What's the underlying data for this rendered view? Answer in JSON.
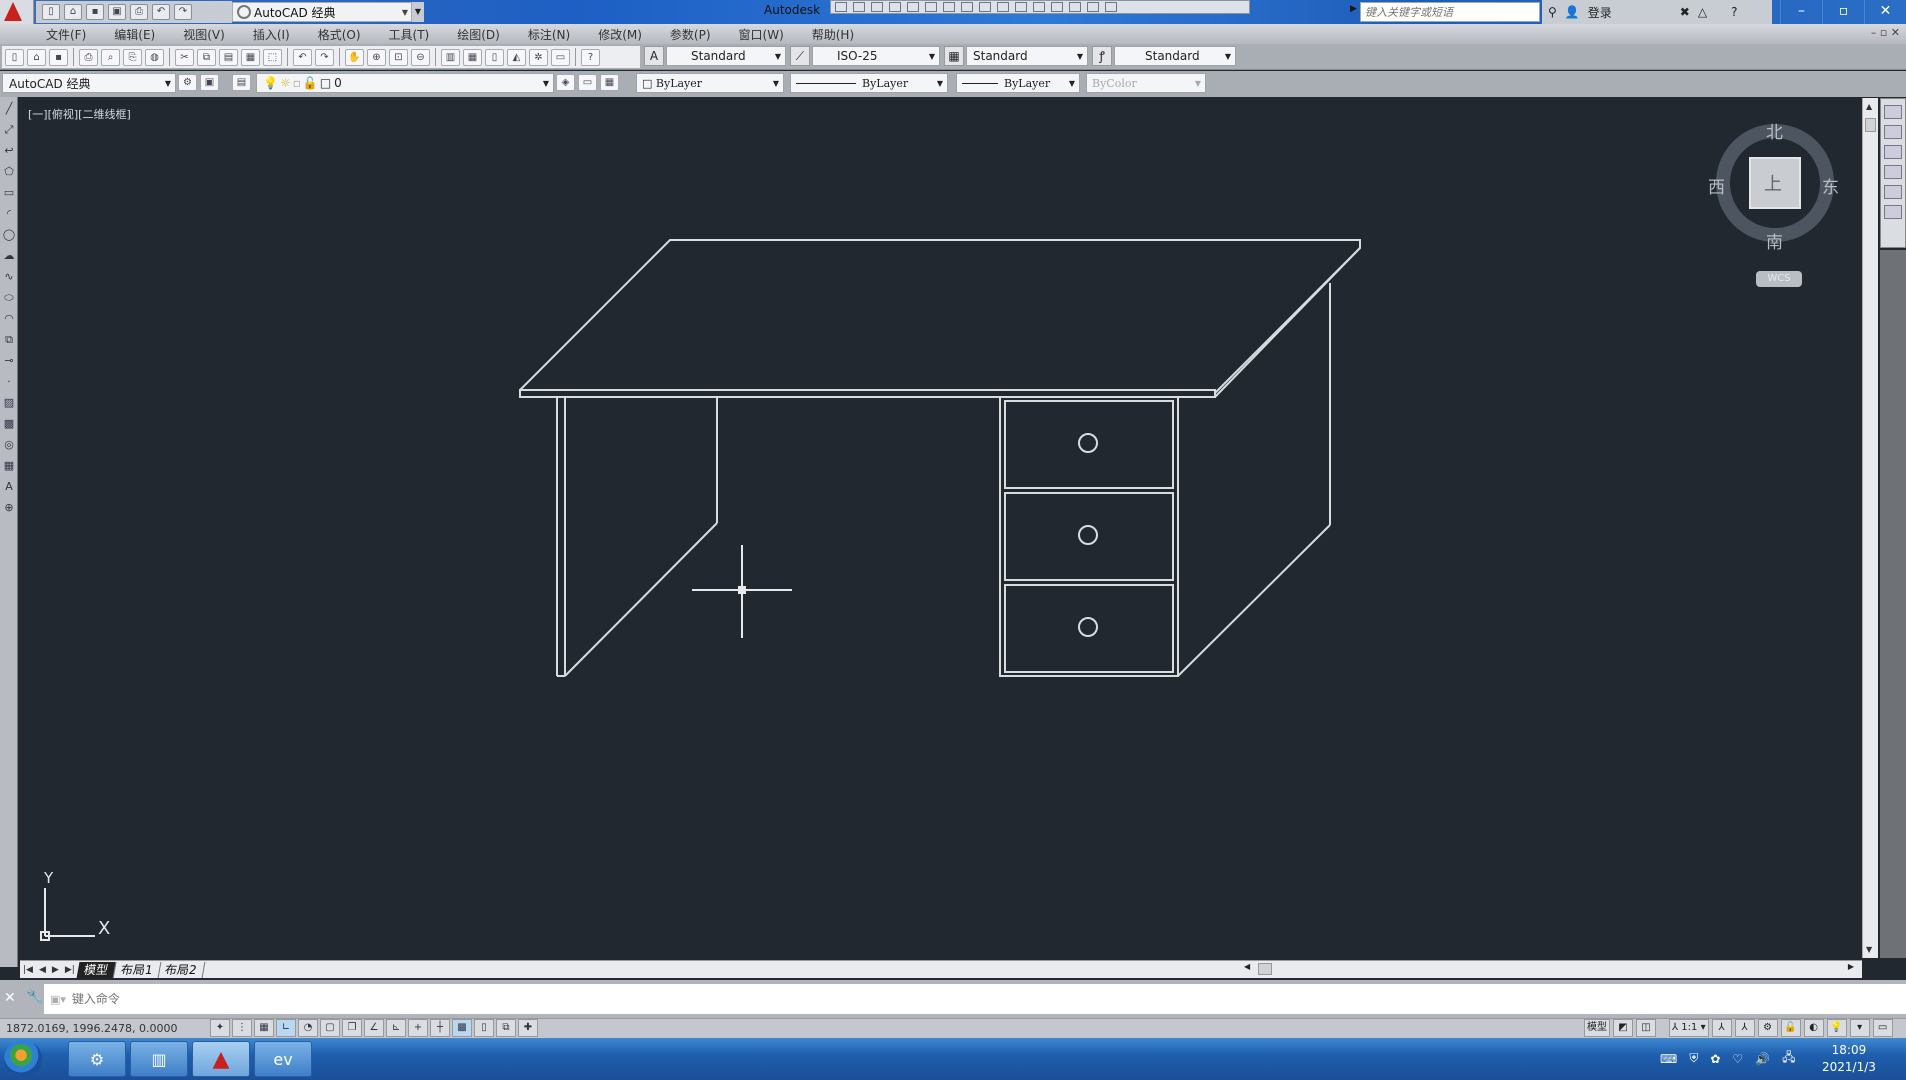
{
  "title_bar": {
    "app_name": "AutoCAD",
    "window_title": "Autodesk",
    "workspace": "AutoCAD 经典",
    "search_placeholder": "键入关键字或短语",
    "login_label": "登录",
    "quick_access": [
      "new-icon",
      "open-icon",
      "save-icon",
      "save-as-icon",
      "print-icon",
      "undo-icon",
      "redo-icon"
    ],
    "window_controls": [
      "minimize",
      "restore",
      "close"
    ]
  },
  "menubar": {
    "items": [
      "文件(F)",
      "编辑(E)",
      "视图(V)",
      "插入(I)",
      "格式(O)",
      "工具(T)",
      "绘图(D)",
      "标注(N)",
      "修改(M)",
      "参数(P)",
      "窗口(W)",
      "帮助(H)"
    ],
    "doc_controls": "– ▫ ✕"
  },
  "styles_toolbar": {
    "text_style": "Standard",
    "dim_style": "ISO-25",
    "table_style": "Standard",
    "multileader_style": "Standard"
  },
  "layers_toolbar": {
    "workspace": "AutoCAD 经典",
    "current_layer": "0",
    "color": "ByLayer",
    "linetype": "ByLayer",
    "lineweight": "ByLayer",
    "plot_style": "ByColor"
  },
  "viewport": {
    "label": "[一][俯视][二维线框]",
    "background": "#212830",
    "line_color": "#d8dcdf"
  },
  "viewcube": {
    "north": "北",
    "south": "南",
    "east": "东",
    "west": "西",
    "face": "上",
    "ucs_label": "WCS"
  },
  "ucs_icon": {
    "x_label": "X",
    "y_label": "Y"
  },
  "layout_tabs": {
    "tabs": [
      "模型",
      "布局1",
      "布局2"
    ],
    "active": "模型"
  },
  "command_line": {
    "placeholder": "键入命令",
    "close": "✕",
    "customize": "🔧"
  },
  "status_bar": {
    "coordinates": "1872.0169,  1996.2478,  0.0000",
    "model_label": "模型",
    "annotation_scale": "1:1",
    "toggles": [
      {
        "name": "infer-constraints",
        "on": false
      },
      {
        "name": "snap",
        "on": false
      },
      {
        "name": "grid",
        "on": false
      },
      {
        "name": "ortho",
        "on": true
      },
      {
        "name": "polar",
        "on": false
      },
      {
        "name": "osnap",
        "on": false
      },
      {
        "name": "3d-osnap",
        "on": false
      },
      {
        "name": "otrack",
        "on": false
      },
      {
        "name": "ducs",
        "on": false
      },
      {
        "name": "dyn",
        "on": false
      },
      {
        "name": "lineweight",
        "on": false
      },
      {
        "name": "transparency",
        "on": true
      },
      {
        "name": "quick-properties",
        "on": false
      },
      {
        "name": "selection-cycling",
        "on": false
      },
      {
        "name": "annotation-monitor",
        "on": false
      }
    ]
  },
  "taskbar": {
    "apps": [
      "file-manager-icon",
      "document-icon",
      "autocad-icon",
      "everything-icon"
    ],
    "active_app": "autocad-icon",
    "time": "18:09",
    "date": "2021/1/3"
  }
}
